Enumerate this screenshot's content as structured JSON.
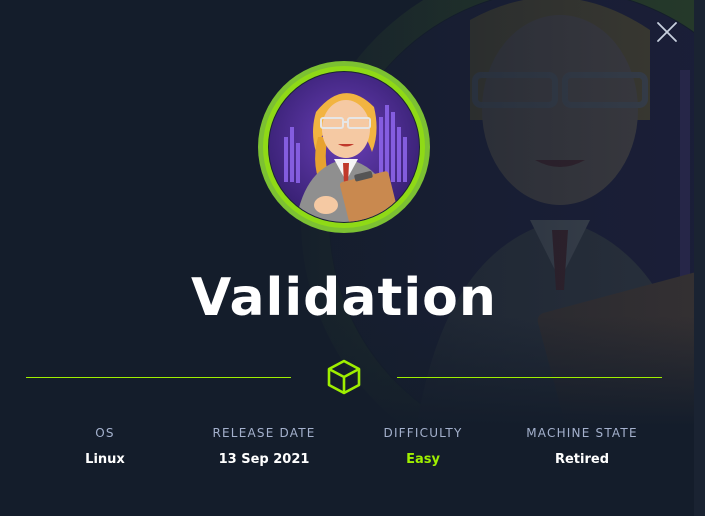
{
  "machine": {
    "name": "Validation",
    "avatar_icon": "hacker-woman-clipboard-avatar",
    "ring_color": "#9fef00"
  },
  "modal": {
    "close_icon": "close-icon",
    "divider_icon": "cube-icon"
  },
  "stats": [
    {
      "label": "OS",
      "value": "Linux"
    },
    {
      "label": "RELEASE DATE",
      "value": "13 Sep 2021"
    },
    {
      "label": "DIFFICULTY",
      "value": "Easy",
      "color": "#9fef00"
    },
    {
      "label": "MACHINE STATE",
      "value": "Retired"
    }
  ],
  "colors": {
    "background": "#141d2b",
    "accent": "#9fef00",
    "label": "#a4b1cd",
    "text": "#ffffff"
  }
}
